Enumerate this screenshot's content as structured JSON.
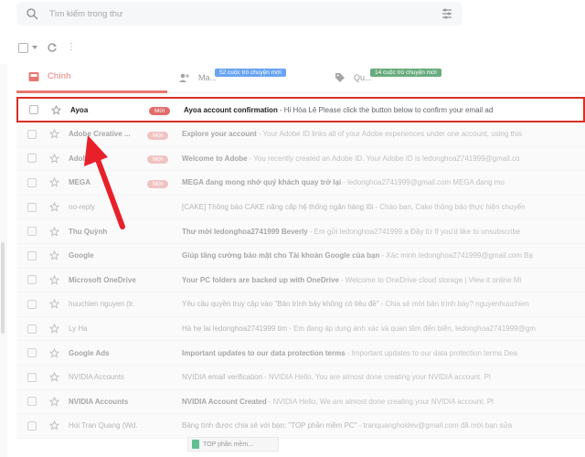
{
  "search": {
    "placeholder": "Tìm kiếm trong thư"
  },
  "tabs": [
    {
      "label": "Chính",
      "badge": "",
      "color": "#d93025"
    },
    {
      "label": "Ma...",
      "badge": "52 cuộc trò chuyện mới",
      "color": "#1a73e8"
    },
    {
      "label": "Qu...",
      "badge": "14 cuộc trò chuyện mới",
      "color": "#188038"
    }
  ],
  "emails": [
    {
      "sender": "Ayoa",
      "badge": "Mới",
      "subject": "Ayoa account confirmation",
      "snippet": " - Hi Hòa Lê Please click the button below to confirm your email ad",
      "highlight": true
    },
    {
      "sender": "Adobe Creative ...",
      "badge": "Mới",
      "subject": "Explore your account",
      "snippet": " - Your Adobe ID links all of your Adobe experiences under one account, using this"
    },
    {
      "sender": "Adobe",
      "badge": "Mới",
      "subject": "Welcome to Adobe",
      "snippet": " - You recently created an Adobe ID. Your Adobe ID is ledonghoa2741999@gmail.co"
    },
    {
      "sender": "MEGA",
      "badge": "Mới",
      "subject": "MEGA đang mong nhớ quý khách quay trở lại",
      "snippet": " - ledonghoa2741999@gmail.com MEGA đang mo"
    },
    {
      "sender": "no-reply",
      "badge": "",
      "subject": "[CAKE] Thông báo CAKE nâng cấp hệ thống ngân hàng lõi",
      "snippet": " - Chào bạn, Cake thông báo thực hiện chuyển",
      "normal": true
    },
    {
      "sender": "Thu Quỳnh",
      "badge": "",
      "subject": "Thư mời ledonghoa2741999 Beverly",
      "snippet": " - Em gửi ledonghoa2741999 ạ Đây từ If you'd like to unsubscribe"
    },
    {
      "sender": "Google",
      "badge": "",
      "subject": "Giúp tăng cường bảo mật cho Tài khoản Google của bạn",
      "snippet": " - Xác minh ledonghoa2741999@gmail.com Bạ"
    },
    {
      "sender": "Microsoft OneDrive",
      "badge": "",
      "subject": "Your PC folders are backed up with OneDrive",
      "snippet": " - Welcome to OneDrive cloud storage | View it online Mi"
    },
    {
      "sender": "huuchien nguyen (tr.",
      "badge": "",
      "subject": "Yêu cầu quyền truy cập vào \"Bản trình bày không có tiêu đề\"",
      "snippet": " - Chia sẻ mời bản trình bày? nguyenhuuchien",
      "normal": true
    },
    {
      "sender": "Ly Ha",
      "badge": "",
      "subject": "Hà hẹ lai ledonghoa2741999 tim",
      "snippet": " - Em đang áp dụng ánh xác và quan tâm đến biển, ledonghoa2741999@gm",
      "normal": true
    },
    {
      "sender": "Google Ads",
      "badge": "",
      "subject": "Important updates to our data protection terms",
      "snippet": " - Important updates to our data protection terms Dea"
    },
    {
      "sender": "NVIDIA Accounts",
      "badge": "",
      "subject": "NVIDIA email verification",
      "snippet": " - NVIDIA Hello, You are almost done creating your NVIDIA account. Pl",
      "normal": true
    },
    {
      "sender": "NVIDIA Accounts",
      "badge": "",
      "subject": "NVIDIA Account Created",
      "snippet": " - NVIDIA Hello, We are almost done creating your NVIDIA account. Pl"
    },
    {
      "sender": "Hoi Tran Quang (Wd.",
      "badge": "",
      "subject": "Bảng tính được chia sẻ với bạn: \"TOP phần mềm PC\"",
      "snippet": " - tranquanghoidev@gmail.com đã mời bạn sửa",
      "normal": true
    }
  ],
  "bottom": {
    "label": "TOP phần mềm..."
  },
  "colors": {
    "accent": "#d93025",
    "arrow": "#e8202a"
  }
}
